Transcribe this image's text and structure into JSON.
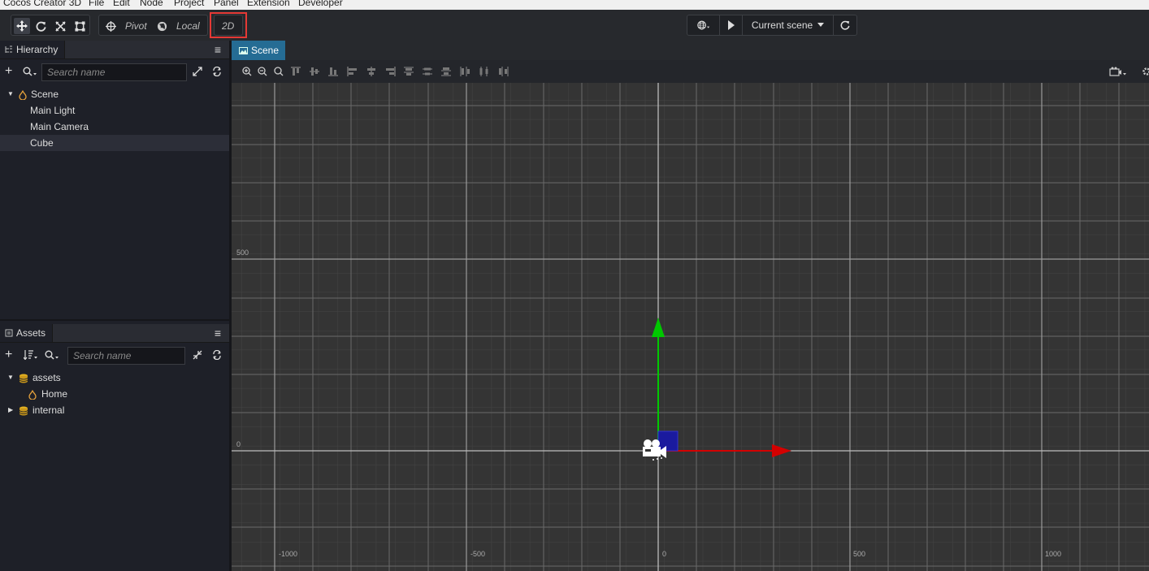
{
  "menubar": [
    "Cocos Creator 3D",
    "File",
    "Edit",
    "Node",
    "Project",
    "Panel",
    "Extension",
    "Developer"
  ],
  "toolbar": {
    "pivot_label": "Pivot",
    "local_label": "Local",
    "mode_2d_label": "2D",
    "scene_select_label": "Current scene"
  },
  "hierarchy": {
    "title": "Hierarchy",
    "search_placeholder": "Search name",
    "root": "Scene",
    "items": [
      "Main Light",
      "Main Camera",
      "Cube"
    ],
    "selected": "Cube"
  },
  "assets": {
    "title": "Assets",
    "search_placeholder": "Search name",
    "items": [
      {
        "label": "assets",
        "children": [
          "Home"
        ]
      },
      {
        "label": "internal"
      }
    ]
  },
  "scene": {
    "tab_label": "Scene",
    "x_axis_labels": [
      "-1000",
      "-500",
      "0",
      "500",
      "1000"
    ],
    "y_axis_labels": [
      "500",
      "0"
    ]
  },
  "colors": {
    "accent_tab": "#256c94",
    "highlight_border": "#e53935",
    "gizmo_y": "#00c800",
    "gizmo_x": "#d40000",
    "gizmo_z": "#1a1a9e"
  }
}
